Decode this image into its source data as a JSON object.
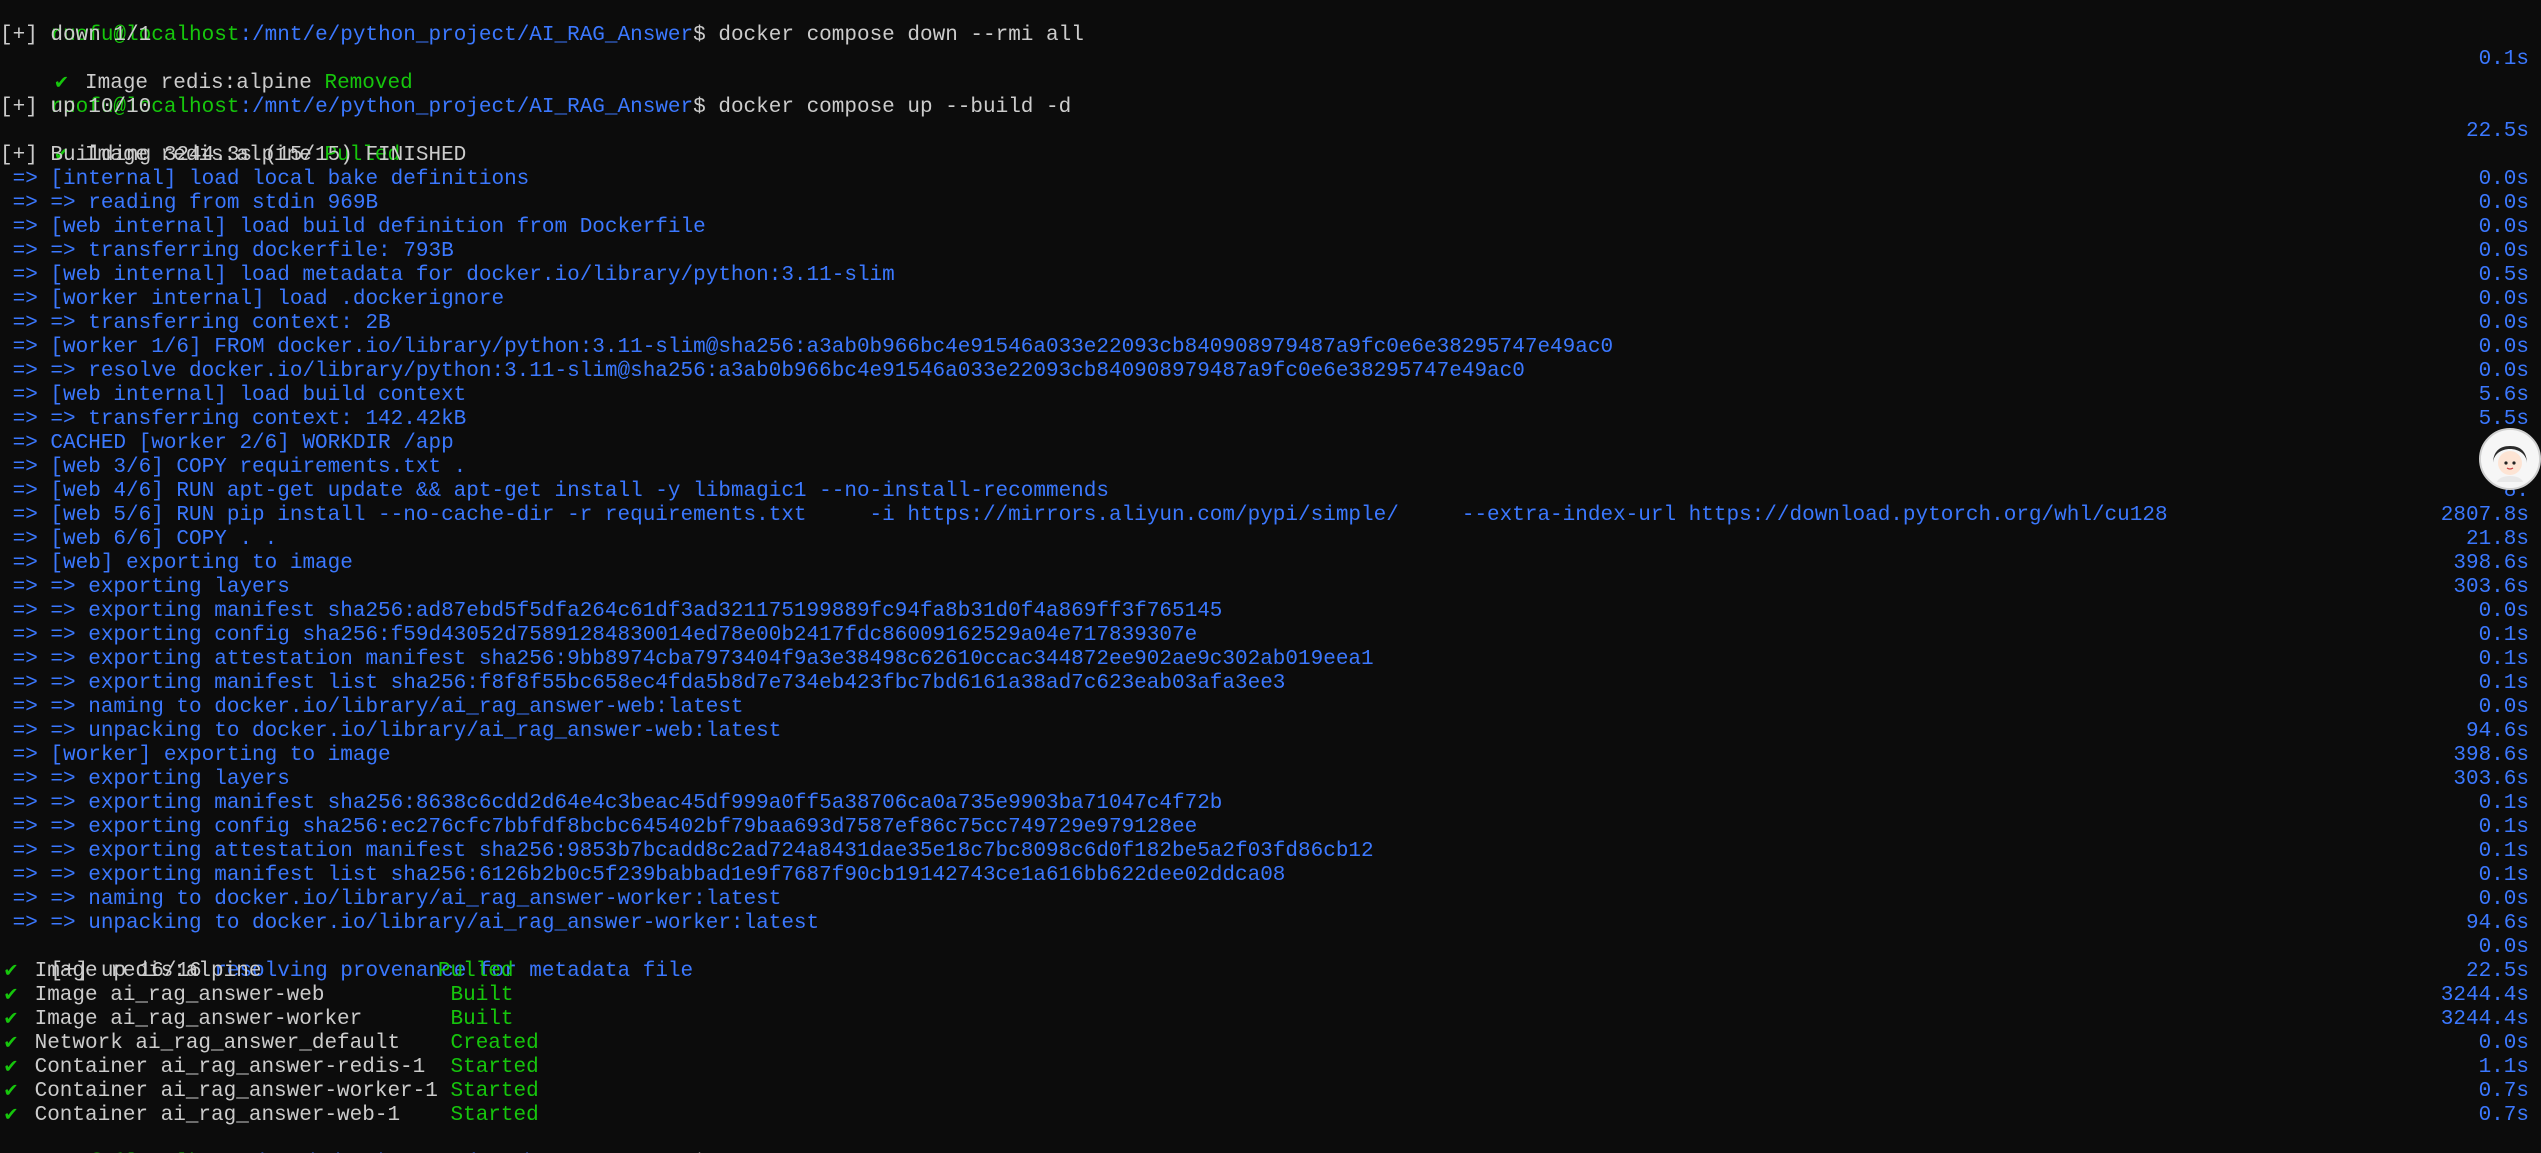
{
  "prompt": {
    "user_host": "ruofu@localhost",
    "path": ":/mnt/e/python_project/AI_RAG_Answer",
    "symbol": "$"
  },
  "commands": {
    "down": " docker compose down --rmi all",
    "up": " docker compose up --build -d"
  },
  "down_section": {
    "header": "[+] down 1/1",
    "items": [
      {
        "check": "✔",
        "name": " Image redis:alpine ",
        "status": "Removed",
        "time": "0.1s"
      }
    ]
  },
  "up_section": {
    "header": "[+] up 10/10",
    "items": [
      {
        "check": "✔",
        "name": " Image redis:alpine ",
        "status": "Pulled",
        "time": "22.5s"
      }
    ]
  },
  "build": {
    "header": "[+] Building 3244.3s (15/15) FINISHED",
    "steps": [
      {
        "text": " => [internal] load local bake definitions",
        "time": "0.0s"
      },
      {
        "text": " => => reading from stdin 969B",
        "time": "0.0s"
      },
      {
        "text": " => [web internal] load build definition from Dockerfile",
        "time": "0.0s"
      },
      {
        "text": " => => transferring dockerfile: 793B",
        "time": "0.0s"
      },
      {
        "text": " => [web internal] load metadata for docker.io/library/python:3.11-slim",
        "time": "0.5s"
      },
      {
        "text": " => [worker internal] load .dockerignore",
        "time": "0.0s"
      },
      {
        "text": " => => transferring context: 2B",
        "time": "0.0s"
      },
      {
        "text": " => [worker 1/6] FROM docker.io/library/python:3.11-slim@sha256:a3ab0b966bc4e91546a033e22093cb840908979487a9fc0e6e38295747e49ac0",
        "time": "0.0s"
      },
      {
        "text": " => => resolve docker.io/library/python:3.11-slim@sha256:a3ab0b966bc4e91546a033e22093cb840908979487a9fc0e6e38295747e49ac0",
        "time": "0.0s"
      },
      {
        "text": " => [web internal] load build context",
        "time": "5.6s"
      },
      {
        "text": " => => transferring context: 142.42kB",
        "time": "5.5s"
      },
      {
        "text": " => CACHED [worker 2/6] WORKDIR /app",
        "time": "0."
      },
      {
        "text": " => [web 3/6] COPY requirements.txt .",
        "time": "0"
      },
      {
        "text": " => [web 4/6] RUN apt-get update && apt-get install -y libmagic1 --no-install-recommends",
        "time": "8."
      },
      {
        "text": " => [web 5/6] RUN pip install --no-cache-dir -r requirements.txt     -i https://mirrors.aliyun.com/pypi/simple/     --extra-index-url https://download.pytorch.org/whl/cu128",
        "time": "2807.8s"
      },
      {
        "text": " => [web 6/6] COPY . .",
        "time": "21.8s"
      },
      {
        "text": " => [web] exporting to image",
        "time": "398.6s"
      },
      {
        "text": " => => exporting layers",
        "time": "303.6s"
      },
      {
        "text": " => => exporting manifest sha256:ad87ebd5f5dfa264c61df3ad321175199889fc94fa8b31d0f4a869ff3f765145",
        "time": "0.0s"
      },
      {
        "text": " => => exporting config sha256:f59d43052d75891284830014ed78e00b2417fdc86009162529a04e717839307e",
        "time": "0.1s"
      },
      {
        "text": " => => exporting attestation manifest sha256:9bb8974cba7973404f9a3e38498c62610ccac344872ee902ae9c302ab019eea1",
        "time": "0.1s"
      },
      {
        "text": " => => exporting manifest list sha256:f8f8f55bc658ec4fda5b8d7e734eb423fbc7bd6161a38ad7c623eab03afa3ee3",
        "time": "0.1s"
      },
      {
        "text": " => => naming to docker.io/library/ai_rag_answer-web:latest",
        "time": "0.0s"
      },
      {
        "text": " => => unpacking to docker.io/library/ai_rag_answer-web:latest",
        "time": "94.6s"
      },
      {
        "text": " => [worker] exporting to image",
        "time": "398.6s"
      },
      {
        "text": " => => exporting layers",
        "time": "303.6s"
      },
      {
        "text": " => => exporting manifest sha256:8638c6cdd2d64e4c3beac45df999a0ff5a38706ca0a735e9903ba71047c4f72b",
        "time": "0.1s"
      },
      {
        "text": " => => exporting config sha256:ec276cfc7bbfdf8bcbc645402bf79baa693d7587ef86c75cc749729e979128ee",
        "time": "0.1s"
      },
      {
        "text": " => => exporting attestation manifest sha256:9853b7bcadd8c2ad724a8431dae35e18c7bc8098c6d0f182be5a2f03fd86cb12",
        "time": "0.1s"
      },
      {
        "text": " => => exporting manifest list sha256:6126b2b0c5f239babbad1e9f7687f90cb19142743ce1a616bb622dee02ddca08",
        "time": "0.1s"
      },
      {
        "text": " => => naming to docker.io/library/ai_rag_answer-worker:latest",
        "time": "0.0s"
      },
      {
        "text": " => => unpacking to docker.io/library/ai_rag_answer-worker:latest",
        "time": "94.6s"
      }
    ]
  },
  "final": {
    "header": "[+] up 16/16 ",
    "header_extra": "resolving provenance for metadata file",
    "header_time": "0.0s",
    "items": [
      {
        "check": "✔",
        "name": " Image redis:alpine              ",
        "status": "Pulled",
        "time": "22.5s"
      },
      {
        "check": "✔",
        "name": " Image ai_rag_answer-web          ",
        "status": "Built",
        "time": "3244.4s"
      },
      {
        "check": "✔",
        "name": " Image ai_rag_answer-worker       ",
        "status": "Built",
        "time": "3244.4s"
      },
      {
        "check": "✔",
        "name": " Network ai_rag_answer_default    ",
        "status": "Created",
        "time": "0.0s"
      },
      {
        "check": "✔",
        "name": " Container ai_rag_answer-redis-1  ",
        "status": "Started",
        "time": "1.1s"
      },
      {
        "check": "✔",
        "name": " Container ai_rag_answer-worker-1 ",
        "status": "Started",
        "time": "0.7s"
      },
      {
        "check": "✔",
        "name": " Container ai_rag_answer-web-1    ",
        "status": "Started",
        "time": "0.7s"
      }
    ]
  },
  "colors": {
    "background": "#0c0c0c",
    "prompt_host": "#16c60c",
    "prompt_path": "#3b78ff",
    "build_text": "#3b78ff",
    "status_green": "#16c60c",
    "default_text": "#cccccc"
  },
  "floating_avatar": {
    "icon": "avatar-icon"
  }
}
